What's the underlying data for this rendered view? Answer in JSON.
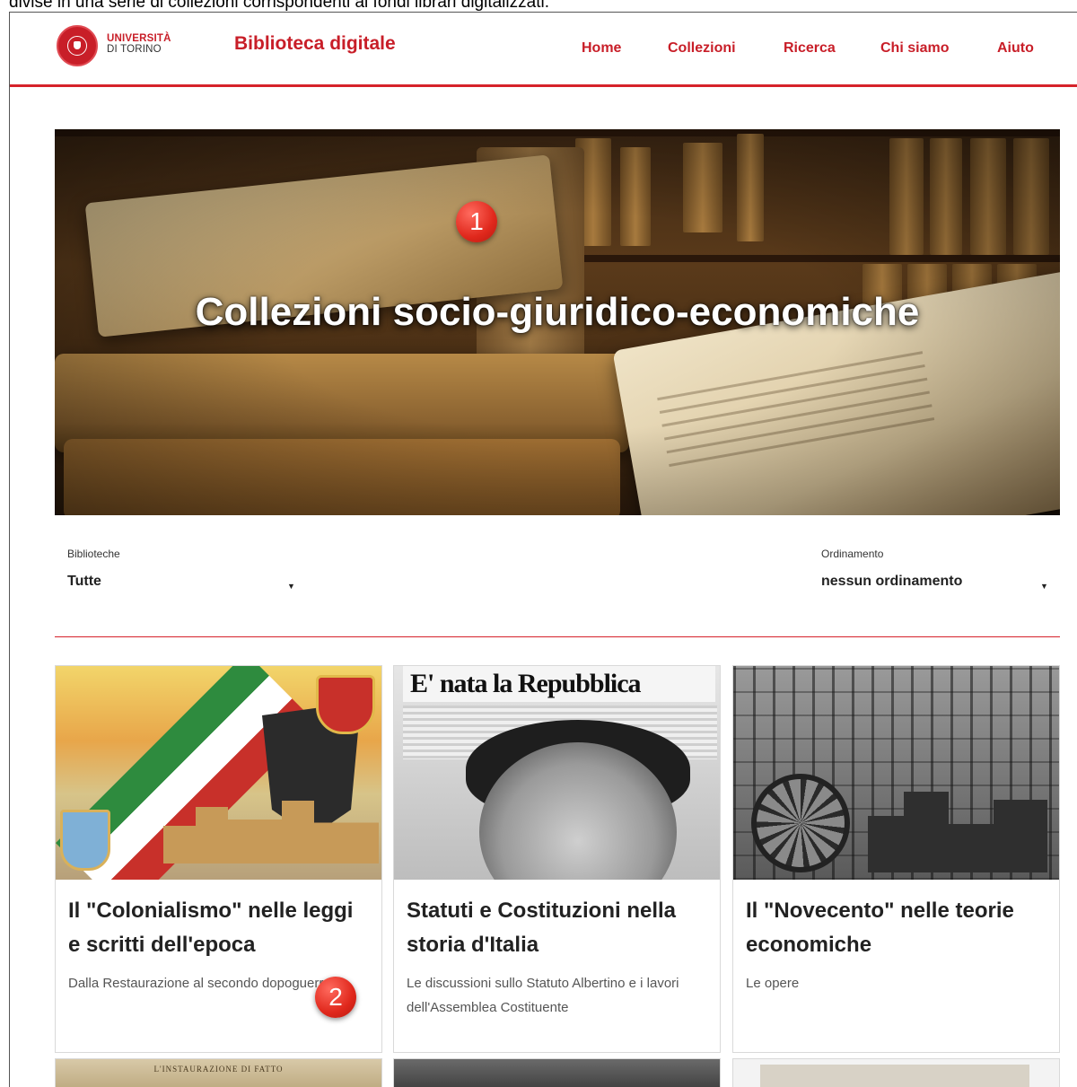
{
  "caption": "divise in una serie di collezioni corrispondenti ai fondi librari digitalizzati.",
  "logo": {
    "line1": "UNIVERSITÀ",
    "line2": "DI TORINO"
  },
  "site_title": "Biblioteca digitale",
  "nav": [
    "Home",
    "Collezioni",
    "Ricerca",
    "Chi siamo",
    "Aiuto"
  ],
  "hero": {
    "title": "Collezioni socio-giuridico-economiche"
  },
  "badges": [
    "1",
    "2"
  ],
  "filters": {
    "library": {
      "label": "Biblioteche",
      "value": "Tutte"
    },
    "sort": {
      "label": "Ordinamento",
      "value": "nessun ordinamento"
    }
  },
  "cards": [
    {
      "title": "Il \"Colonialismo\" nelle leggi e scritti dell'epoca",
      "subtitle": "Dalla Restaurazione al secondo dopoguerra"
    },
    {
      "title": "Statuti e Costituzioni nella storia d'Italia",
      "subtitle": "Le discussioni sullo Statuto Albertino e i lavori dell'Assemblea Costituente",
      "image_text": "E' nata la Repubblica"
    },
    {
      "title": "Il \"Novecento\" nelle teorie economiche",
      "subtitle": "Le opere"
    }
  ],
  "peek": {
    "first_image_text": "L'INSTAURAZIONE DI FATTO"
  },
  "colors": {
    "accent": "#c81e28",
    "divider": "#d6222a",
    "badge": "#e0281c"
  }
}
